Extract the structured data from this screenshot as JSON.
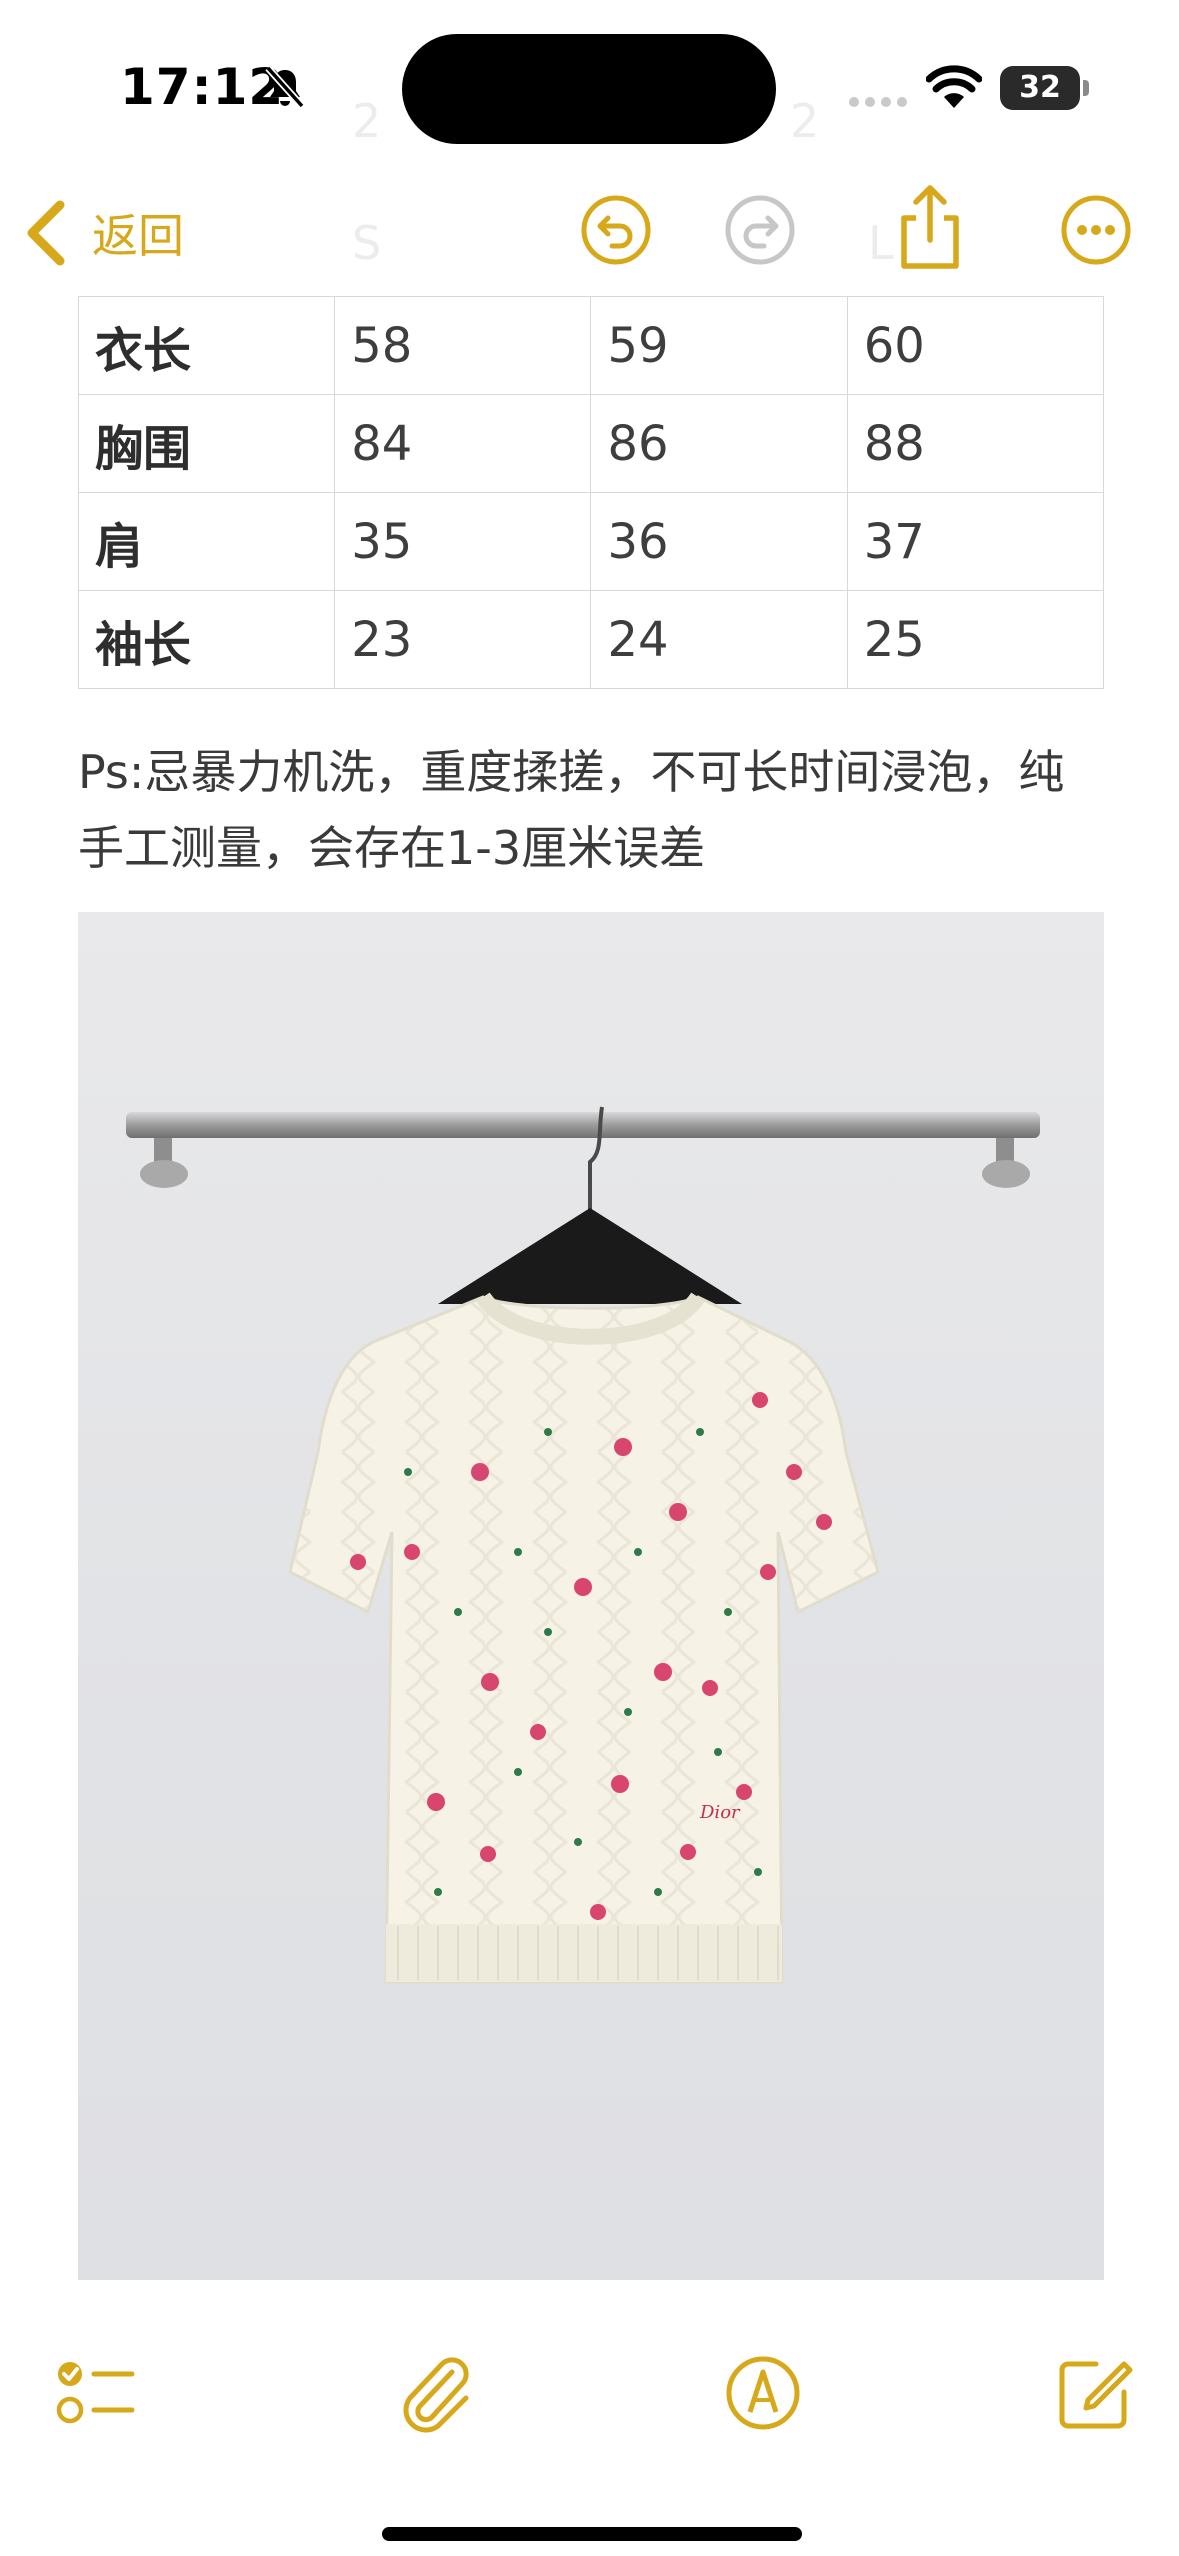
{
  "status_bar": {
    "time": "17:12",
    "battery": "32"
  },
  "nav": {
    "back_label": "返回",
    "ghost_top": "2",
    "ghost_top_right": "2",
    "ghost_s": "S",
    "ghost_l": "L"
  },
  "icons": {
    "bell": "bell-slash-icon",
    "wifi": "wifi-icon",
    "undo": "undo-icon",
    "redo": "redo-icon",
    "share": "share-icon",
    "more": "more-icon",
    "checklist": "checklist-icon",
    "attach": "paperclip-icon",
    "markup": "markup-pen-icon",
    "compose": "compose-icon"
  },
  "colors": {
    "accent": "#D6A81A",
    "disabled": "#C7C7C7"
  },
  "table": {
    "rows": [
      {
        "label": "衣长",
        "values": [
          "58",
          "59",
          "60"
        ]
      },
      {
        "label": "胸围",
        "values": [
          "84",
          "86",
          "88"
        ]
      },
      {
        "label": "肩",
        "values": [
          "35",
          "36",
          "37"
        ]
      },
      {
        "label": "袖长",
        "values": [
          "23",
          "24",
          "25"
        ]
      }
    ]
  },
  "note": "Ps:忌暴力机洗，重度揉搓，不可长时间浸泡，纯手工测量，会存在1-3厘米误差",
  "photo": {
    "brand_text": "Dior"
  }
}
